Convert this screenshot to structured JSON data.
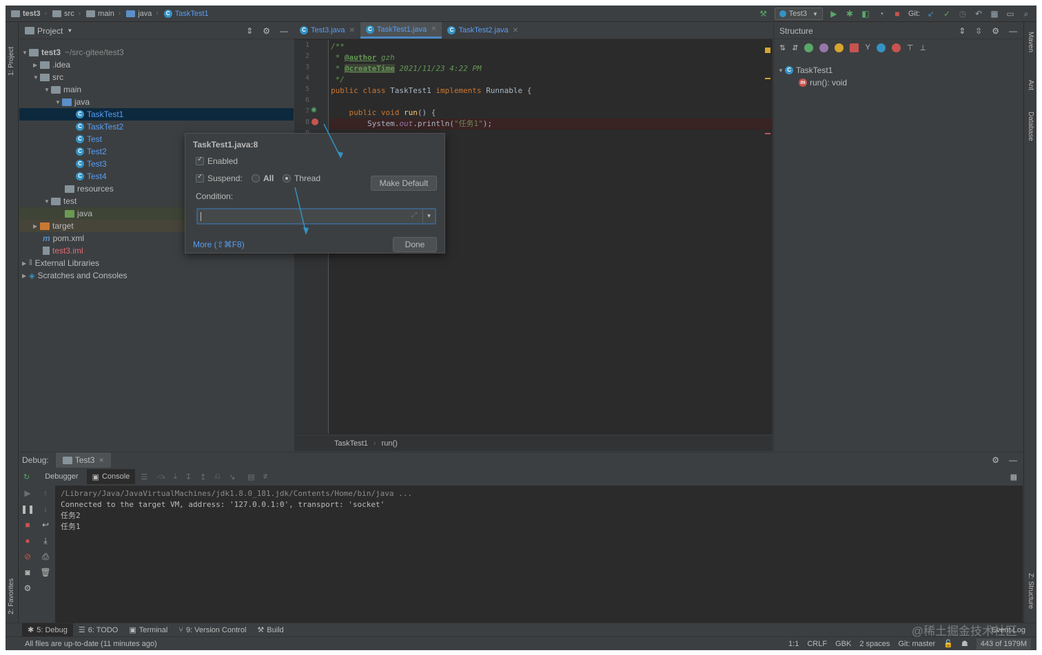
{
  "navbar": {
    "breadcrumbs": [
      "test3",
      "src",
      "main",
      "java",
      "TaskTest1"
    ],
    "run_config": "Test3",
    "git_label": "Git:"
  },
  "left_stripe": {
    "project": "1: Project",
    "favorites": "2: Favorites"
  },
  "right_stripe": {
    "maven": "Maven",
    "ant": "Ant",
    "database": "Database",
    "structure": "Z: Structure"
  },
  "project": {
    "title": "Project",
    "tree": [
      {
        "label": "test3",
        "hint": "~/src-gitee/test3"
      },
      {
        "label": ".idea"
      },
      {
        "label": "src"
      },
      {
        "label": "main"
      },
      {
        "label": "java"
      },
      {
        "label": "TaskTest1"
      },
      {
        "label": "TaskTest2"
      },
      {
        "label": "Test"
      },
      {
        "label": "Test2"
      },
      {
        "label": "Test3"
      },
      {
        "label": "Test4"
      },
      {
        "label": "resources"
      },
      {
        "label": "test"
      },
      {
        "label": "java"
      },
      {
        "label": "target"
      },
      {
        "label": "pom.xml"
      },
      {
        "label": "test3.iml"
      },
      {
        "label": "External Libraries"
      },
      {
        "label": "Scratches and Consoles"
      }
    ]
  },
  "editor": {
    "tabs": [
      "Test3.java",
      "TaskTest1.java",
      "TaskTest2.java"
    ],
    "line_numbers": [
      "1",
      "2",
      "3",
      "4",
      "5",
      "6",
      "7",
      "8",
      "9"
    ],
    "code": {
      "l1": "/**",
      "l2_prefix": " * ",
      "l2_tag": "@author",
      "l2_rest": " gzh",
      "l3_prefix": " * ",
      "l3_tag": "@createTime",
      "l3_rest": " 2021/11/23 4:22 PM",
      "l4": " */",
      "l5_kw": "public class ",
      "l5_name": "TaskTest1 ",
      "l5_kw2": "implements ",
      "l5_rest": "Runnable {",
      "l7_kw": "    public void ",
      "l7_fn": "run",
      "l7_rest": "() {",
      "l8_pre": "        System.",
      "l8_field": "out",
      "l8_mid": ".println(",
      "l8_str": "\"任务1\"",
      "l8_end": ");"
    },
    "breadcrumb": [
      "TaskTest1",
      "run()"
    ]
  },
  "structure": {
    "title": "Structure",
    "items": [
      {
        "label": "TaskTest1"
      },
      {
        "label": "run(): void"
      }
    ]
  },
  "popup": {
    "title": "TaskTest1.java:8",
    "enabled": "Enabled",
    "suspend": "Suspend:",
    "all": "All",
    "thread": "Thread",
    "make_default": "Make Default",
    "condition": "Condition:",
    "more": "More (⇧⌘F8)",
    "done": "Done"
  },
  "debug": {
    "label": "Debug:",
    "tab": "Test3",
    "debugger": "Debugger",
    "console": "Console",
    "lines": [
      "/Library/Java/JavaVirtualMachines/jdk1.8.0_181.jdk/Contents/Home/bin/java ...",
      "Connected to the target VM, address: '127.0.0.1:0', transport: 'socket'",
      "任务2",
      "任务1"
    ]
  },
  "bottombar": {
    "tools": [
      "5: Debug",
      "6: TODO",
      "Terminal",
      "9: Version Control",
      "Build"
    ],
    "event_log": "Event Log"
  },
  "status": {
    "message": "All files are up-to-date (11 minutes ago)",
    "position": "1:1",
    "line_sep": "CRLF",
    "encoding": "GBK",
    "indent": "2 spaces",
    "git": "Git: master",
    "memory": "443 of 1979M"
  },
  "watermark": "@稀土掘金技术社区",
  "colors": {
    "accent": "#4a88c7",
    "bg": "#3c3f41",
    "editor_bg": "#2b2b2b",
    "link": "#589df6"
  }
}
